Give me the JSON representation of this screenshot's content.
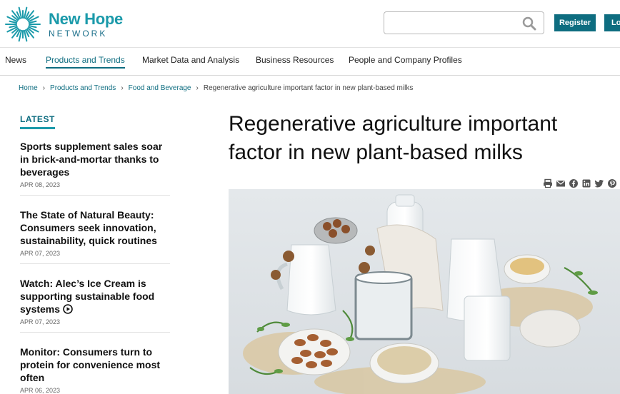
{
  "brand": {
    "name_line1": "New Hope",
    "name_line2": "NETWORK",
    "colors": {
      "primary": "#0e6d80",
      "accent": "#1b9aaa"
    }
  },
  "header": {
    "search_placeholder": "",
    "register_label": "Register",
    "login_label": "Log"
  },
  "nav": {
    "items": [
      {
        "label": "News"
      },
      {
        "label": "Products and Trends",
        "active": true
      },
      {
        "label": "Market Data and Analysis"
      },
      {
        "label": "Business Resources"
      },
      {
        "label": "People and Company Profiles"
      }
    ]
  },
  "breadcrumb": {
    "items": [
      "Home",
      "Products and Trends",
      "Food and Beverage"
    ],
    "current": "Regenerative agriculture important factor in new plant-based milks"
  },
  "sidebar": {
    "heading": "LATEST",
    "stories": [
      {
        "title": "Sports supplement sales soar in brick-and-mortar thanks to beverages",
        "date": "APR 08, 2023"
      },
      {
        "title": "The State of Natural Beauty: Consumers seek innovation, sustainability, quick routines",
        "date": "APR 07, 2023"
      },
      {
        "title": "Watch: Alec’s Ice Cream is supporting sustainable food systems",
        "date": "APR 07, 2023",
        "video": true
      },
      {
        "title": "Monitor: Consumers turn to protein for convenience most often",
        "date": "APR 06, 2023"
      }
    ]
  },
  "article": {
    "title": "Regenerative agriculture important factor in new plant-based milks",
    "share_icons": [
      "print-icon",
      "email-icon",
      "facebook-icon",
      "linkedin-icon",
      "twitter-icon",
      "pinterest-icon"
    ]
  }
}
